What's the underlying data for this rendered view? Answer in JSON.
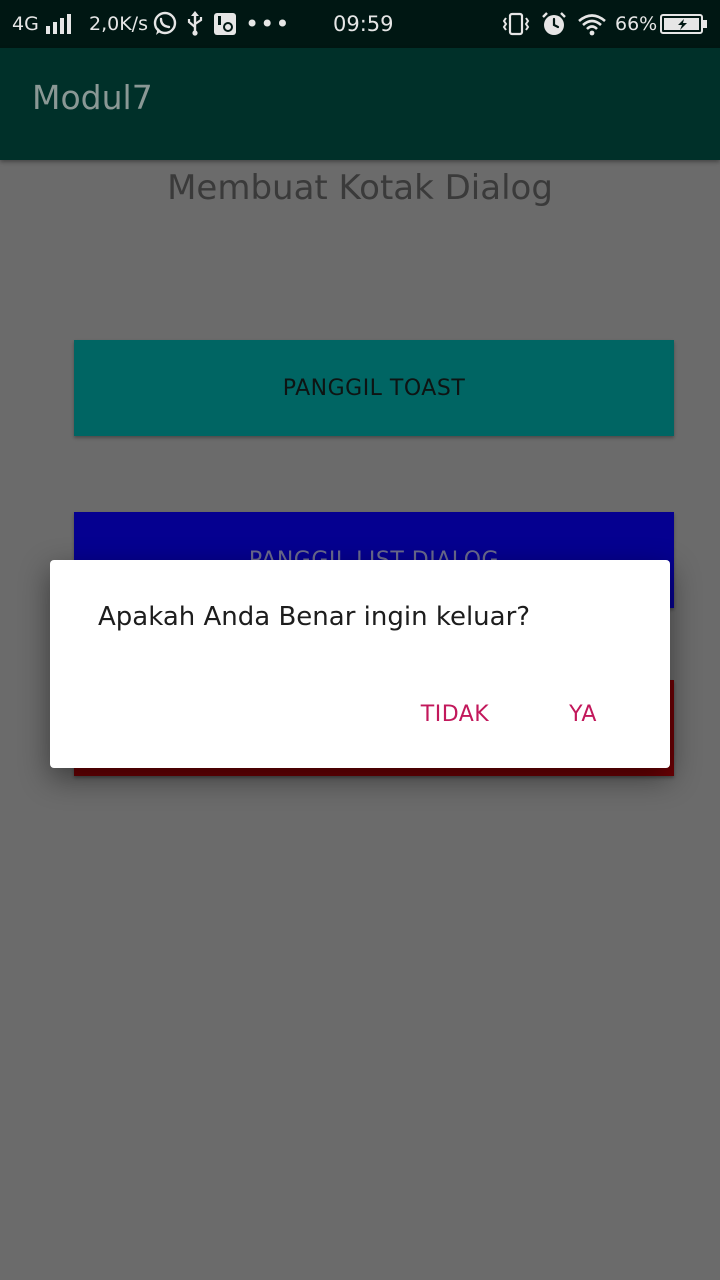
{
  "status_bar": {
    "network": "4G",
    "speed": "2,0K/s",
    "more": "•••",
    "time": "09:59",
    "battery_percent": "66%",
    "icons": [
      "signal-icon",
      "whatsapp-icon",
      "usb-icon",
      "settings-icon",
      "vibrate-icon",
      "alarm-icon",
      "wifi-icon",
      "battery-charging-icon"
    ]
  },
  "app_bar": {
    "title": "Modul7"
  },
  "main": {
    "heading": "Membuat Kotak Dialog",
    "buttons": [
      {
        "label": "PANGGIL TOAST",
        "color": "#006563"
      },
      {
        "label": "PANGGIL LIST DIALOG",
        "color": "#050090"
      },
      {
        "label": "",
        "color": "#6e0004"
      }
    ]
  },
  "dialog": {
    "message": "Apakah Anda Benar ingin keluar?",
    "negative_label": "TIDAK",
    "positive_label": "YA",
    "accent_color": "#c2185b"
  }
}
